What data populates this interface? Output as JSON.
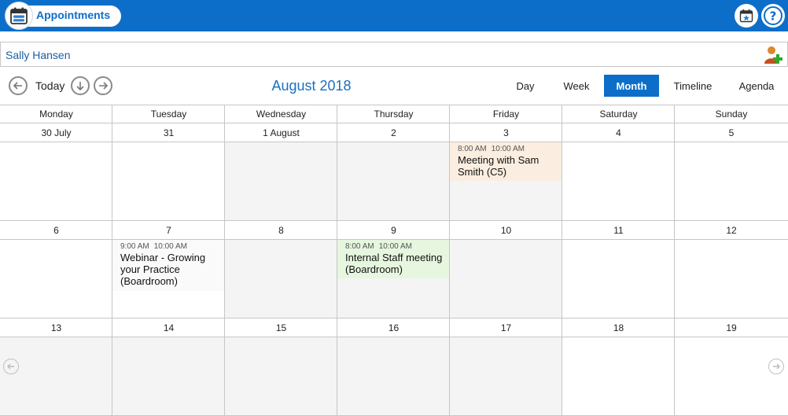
{
  "app": {
    "title": "Appointments"
  },
  "patient": {
    "name": "Sally Hansen"
  },
  "nav": {
    "today_label": "Today",
    "month_title": "August 2018"
  },
  "views": [
    {
      "label": "Day",
      "active": false
    },
    {
      "label": "Week",
      "active": false
    },
    {
      "label": "Month",
      "active": true
    },
    {
      "label": "Timeline",
      "active": false
    },
    {
      "label": "Agenda",
      "active": false
    }
  ],
  "weekdays": [
    "Monday",
    "Tuesday",
    "Wednesday",
    "Thursday",
    "Friday",
    "Saturday",
    "Sunday"
  ],
  "weeks": [
    [
      "30 July",
      "31",
      "1 August",
      "2",
      "3",
      "4",
      "5"
    ],
    [
      "6",
      "7",
      "8",
      "9",
      "10",
      "11",
      "12"
    ],
    [
      "13",
      "14",
      "15",
      "16",
      "17",
      "18",
      "19"
    ]
  ],
  "appointments": [
    {
      "start": "8:00 AM",
      "end": "10:00 AM",
      "title": "Meeting with Sam Smith (C5)",
      "color": "#fbeee0"
    },
    {
      "start": "9:00 AM",
      "end": "10:00 AM",
      "title": "Webinar - Growing your Practice (Boardroom)",
      "color": "#fafafa"
    },
    {
      "start": "8:00 AM",
      "end": "10:00 AM",
      "title": "Internal Staff meeting (Boardroom)",
      "color": "#e6f6df"
    }
  ],
  "icons": {
    "app": "calendar-icon",
    "calendar_star": "calendar-star-icon",
    "help": "help-icon",
    "add_patient": "add-person-icon",
    "prev": "arrow-left-circle-icon",
    "down": "arrow-down-circle-icon",
    "next": "arrow-right-circle-icon"
  },
  "colors": {
    "brand": "#0d6ec9",
    "accent_text": "#1a70c4"
  }
}
